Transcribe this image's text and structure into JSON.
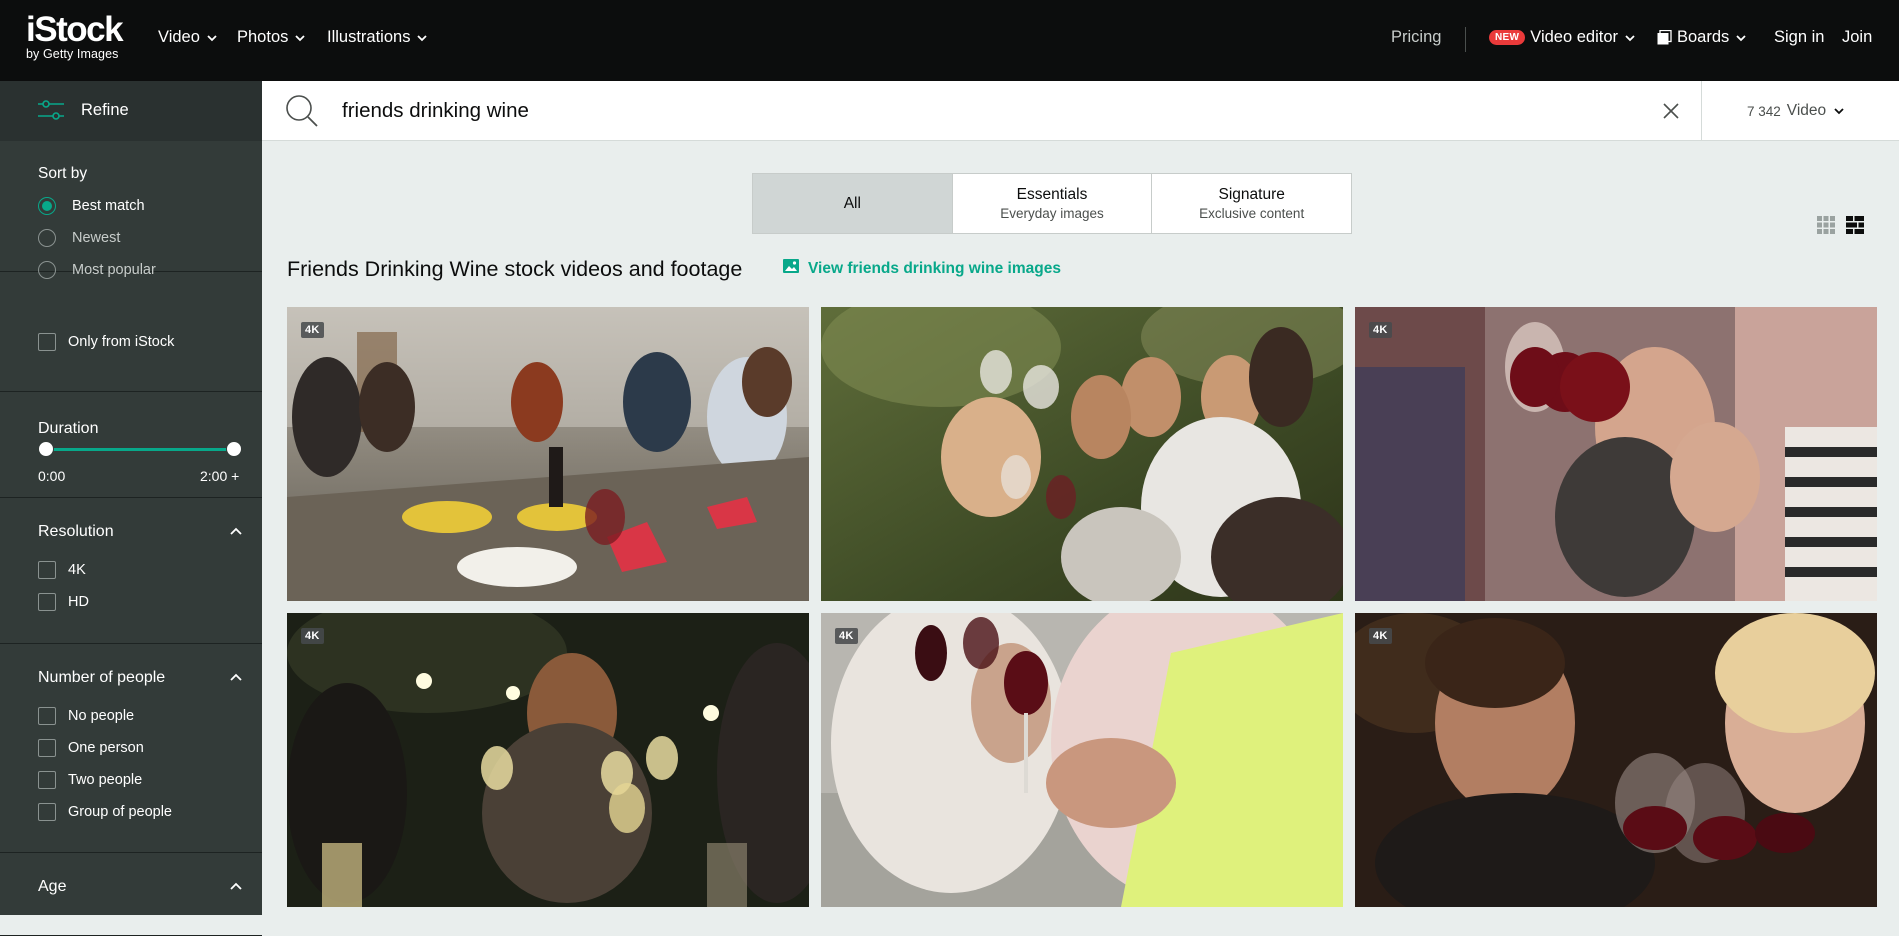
{
  "brand": {
    "logo": "iStock",
    "logo_sub": "by Getty Images",
    "accent": "#08a88a"
  },
  "nav": {
    "video": "Video",
    "photos": "Photos",
    "illustrations": "Illustrations",
    "pricing": "Pricing",
    "new_badge": "NEW",
    "video_editor": "Video editor",
    "boards": "Boards",
    "sign_in": "Sign in",
    "join": "Join"
  },
  "sidebar": {
    "refine": "Refine",
    "sort_by": {
      "title": "Sort by",
      "options": [
        {
          "label": "Best match",
          "selected": true
        },
        {
          "label": "Newest",
          "selected": false
        },
        {
          "label": "Most popular",
          "selected": false
        }
      ]
    },
    "only_from_istock": "Only from iStock",
    "duration": {
      "title": "Duration",
      "min": "0:00",
      "max": "2:00 +"
    },
    "resolution": {
      "title": "Resolution",
      "options": [
        "4K",
        "HD"
      ]
    },
    "number_of_people": {
      "title": "Number of people",
      "options": [
        "No people",
        "One person",
        "Two people",
        "Group of people"
      ]
    },
    "age": {
      "title": "Age"
    }
  },
  "search": {
    "query": "friends drinking wine",
    "results_count": "7 342",
    "results_type": "Video"
  },
  "tabs": [
    {
      "title": "All",
      "subtitle": "",
      "active": true
    },
    {
      "title": "Essentials",
      "subtitle": "Everyday images",
      "active": false
    },
    {
      "title": "Signature",
      "subtitle": "Exclusive content",
      "active": false
    }
  ],
  "heading": {
    "title": "Friends Drinking Wine stock videos and footage",
    "images_link": "View friends drinking wine images"
  },
  "results": [
    {
      "badge": "4K",
      "scene": "outdoor-dinner-table"
    },
    {
      "badge": "",
      "scene": "toast-in-garden"
    },
    {
      "badge": "4K",
      "scene": "red-wine-clink-closeup"
    },
    {
      "badge": "4K",
      "scene": "evening-string-lights-toast"
    },
    {
      "badge": "4K",
      "scene": "holding-red-wine-glasses"
    },
    {
      "badge": "4K",
      "scene": "couple-toast-bar"
    }
  ]
}
